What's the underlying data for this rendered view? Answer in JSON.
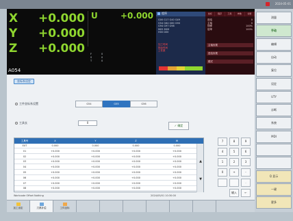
{
  "top": {
    "clock": "2024-05-01"
  },
  "dro": {
    "axes": [
      {
        "letter": "X",
        "value": "+0.000"
      },
      {
        "letter": "Y",
        "value": "+0.000"
      },
      {
        "letter": "Z",
        "value": "+0.000"
      }
    ],
    "u": {
      "letter": "U",
      "value": "+0.000"
    },
    "program": "A054",
    "small_grid": [
      "F",
      "0",
      "S",
      "0",
      "T",
      "0"
    ]
  },
  "status_panel": {
    "title": "程序",
    "lines": [
      "G00 G17 G40 G49",
      "G54 G64 G80 G90",
      "G94 G97 G98",
      "M05 M09",
      "H00 D00"
    ],
    "lines2": [
      "加工时间",
      "剩余时间",
      "工件数"
    ],
    "load_colors": [
      "#e23434",
      "#e2a234",
      "#e2d234",
      "#8fd62f",
      "#8fd62f"
    ]
  },
  "right_panel": {
    "tabs": [
      "坐标",
      "程序",
      "刀具",
      "参数",
      "诊断"
    ],
    "rows": [
      [
        "进给",
        "0"
      ],
      [
        "主轴",
        "0"
      ],
      [
        "快移",
        "100%"
      ],
      [
        "倍率",
        "100%"
      ]
    ],
    "fields": [
      "主轴负载",
      "进给负载",
      "模式"
    ]
  },
  "content": {
    "mode_label": "坐标系设定",
    "row1_label": "工件坐标系设置",
    "segments": [
      "G54",
      "G55",
      "G56"
    ],
    "active_segment": 1,
    "row2_label": "工具长",
    "value_box": "0",
    "confirm_label": "确定",
    "table": {
      "headers": [
        "工具号",
        "X",
        "Y",
        "Z",
        "W"
      ],
      "rows": [
        [
          "EXT",
          "0.000",
          "0.000",
          "0.000",
          "0.000"
        ],
        [
          "01",
          "+0.000",
          "+0.000",
          "+0.000",
          "+0.000"
        ],
        [
          "02",
          "+0.000",
          "+0.000",
          "+0.000",
          "+0.000"
        ],
        [
          "03",
          "+0.000",
          "+0.000",
          "+0.000",
          "+0.000"
        ],
        [
          "04",
          "+0.000",
          "+0.000",
          "+0.000",
          "+0.000"
        ],
        [
          "05",
          "+0.000",
          "+0.000",
          "+0.000",
          "+0.000"
        ],
        [
          "06",
          "+0.000",
          "+0.000",
          "+0.000",
          "+0.000"
        ],
        [
          "07",
          "+0.000",
          "+0.000",
          "+0.000",
          "+0.000"
        ],
        [
          "08",
          "+0.000",
          "+0.000",
          "+0.000",
          "+0.000"
        ]
      ]
    },
    "footer_text": "Workcode Offset Nothing",
    "footer_date": "2024/05/01 10:30:00"
  },
  "keypad": {
    "keys": [
      "7",
      "8",
      "9",
      "4",
      "5",
      "6",
      "1",
      "2",
      "3",
      "0",
      "+",
      "-",
      "",
      "",
      "."
    ],
    "enter": "输入",
    "clear": "←"
  },
  "bottom_tabs": [
    {
      "label": "加工设定"
    },
    {
      "label": "刀具补偿"
    },
    {
      "label": "工件坐标"
    }
  ],
  "softkeys": [
    "测量",
    "手动",
    "编辑",
    "自动",
    "复位",
    "设定",
    "UTY",
    "诊断",
    "系统",
    "MDI",
    "",
    "",
    "Q 显示",
    "一键",
    "更多"
  ]
}
